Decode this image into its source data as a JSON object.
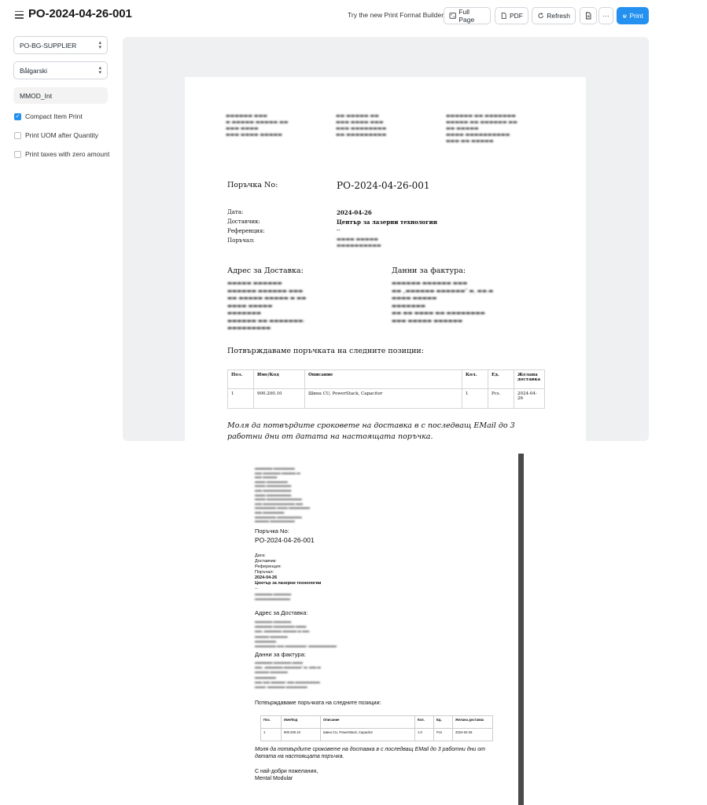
{
  "toolbar": {
    "title": "PO-2024-04-26-001",
    "try_link": "Try the new Print Format Builder",
    "full_page": "Full Page",
    "pdf": "PDF",
    "refresh": "Refresh",
    "more": "···",
    "print": "Print"
  },
  "sidebar": {
    "print_format": "PO-BG-SUPPLIER",
    "language": "Bålgarski",
    "letterhead": "MMOD_Int",
    "options": [
      {
        "label": "Compact Item Print",
        "checked": true
      },
      {
        "label": "Print UOM after Quantity",
        "checked": false
      },
      {
        "label": "Print taxes with zero amount",
        "checked": false
      }
    ]
  },
  "preview": {
    "order_label": "Поръчка No:",
    "order_no": "PO-2024-04-26-001",
    "date_label": "Дата:",
    "supplier_label": "Доставчик:",
    "reference_label": "Референция:",
    "ordered_by_label": "Поръчал:",
    "date_value": "2024-04-26",
    "supplier_value": "Център за лазерни технологии",
    "reference_value": "--",
    "delivery_heading": "Адрес за Доставка:",
    "billing_heading": "Данни за фактура:",
    "confirm_text": "Потвърждаваме поръчката на следните позиции:",
    "table_headers": [
      "Поз.",
      "Име/Код",
      "Описание",
      "Кол.",
      "Ед.",
      "Желана доставка"
    ],
    "table_row": [
      "1",
      "900.200.10",
      "Шина CU, PowerStack, Capacitor",
      "1",
      "Pcs.",
      "2024-04-26"
    ],
    "footer_note": "Моля да потвърдите сроковете на доставка в с последващ EMail до 3 работни дни от датата на настоящата поръчка."
  },
  "pdf": {
    "order_label": "Поръчка No:",
    "order_no": "PO-2024-04-26-001",
    "date_label": "Дата:",
    "supplier_label": "Доставчик:",
    "reference_label": "Референция:",
    "ordered_by_label": "Поръчал:",
    "date_value": "2024-04-26",
    "supplier_value": "Център за лазерни технологии",
    "reference_value": "--",
    "delivery_heading": "Адрес за Доставка:",
    "billing_heading": "Данни за фактура:",
    "confirm_text": "Потвърждаваме поръчката на следните позиции:",
    "table_headers": [
      "Поз.",
      "Име/Код",
      "Описание",
      "Кол.",
      "Ед.",
      "Желана доставка"
    ],
    "table_row": [
      "1",
      "900.200.10",
      "Шина CU, PowerStack, Capacitor",
      "1.0",
      "Pcs",
      "2024-04-26"
    ],
    "footer_note": "Моля да потвърдите сроковете на доставка в с последващ EMail до 3 работни дни от датата на настоящата поръчка.",
    "regards": "С най-добри пожелания,",
    "company": "Mental Modular"
  },
  "colors": {
    "accent": "#2490ef",
    "preview_bg": "#eef0f2",
    "scrollbar": "#4a4a4a"
  }
}
